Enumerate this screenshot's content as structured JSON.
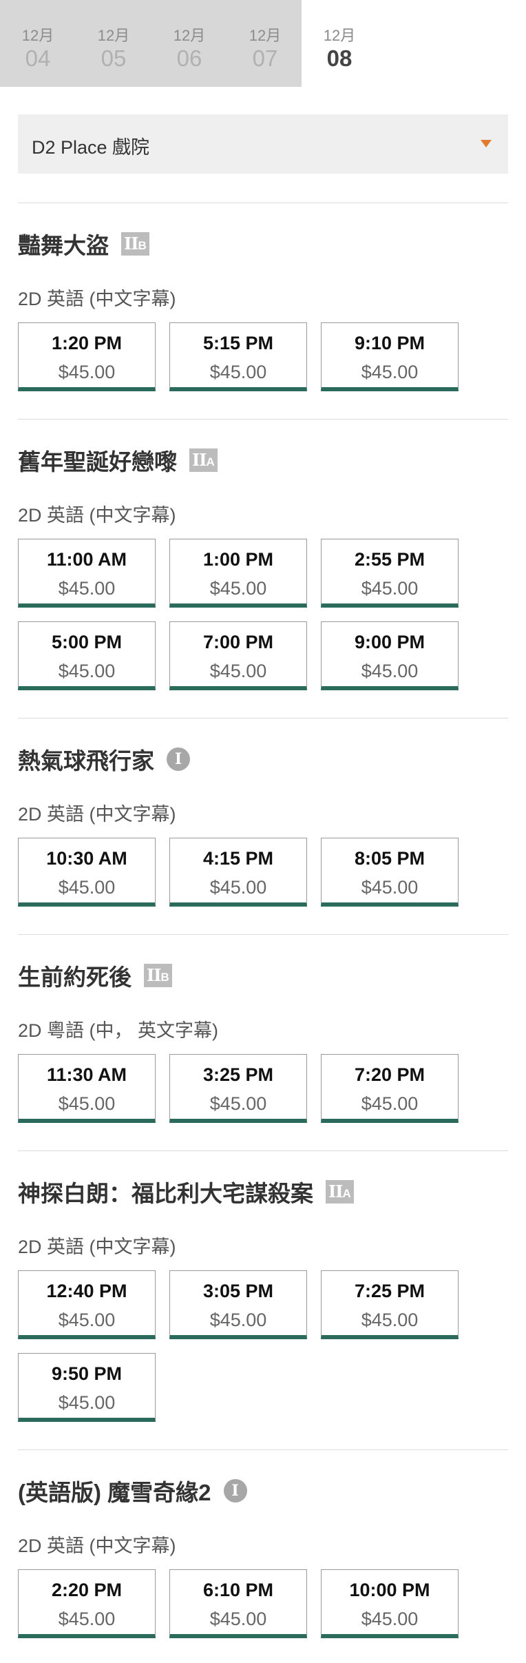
{
  "dates": [
    {
      "month": "12月",
      "day": "04"
    },
    {
      "month": "12月",
      "day": "05"
    },
    {
      "month": "12月",
      "day": "06"
    },
    {
      "month": "12月",
      "day": "07"
    },
    {
      "month": "12月",
      "day": "08"
    }
  ],
  "cinema": {
    "selected": "D2 Place 戲院"
  },
  "colors": {
    "accent": "#e27a2f",
    "slot_border": "#2b6b5c"
  },
  "movies": [
    {
      "title": "豔舞大盜",
      "rating": "IIB",
      "rating_main": "II",
      "rating_sub": "B",
      "format": "2D 英語 (中文字幕)",
      "slots": [
        {
          "time": "1:20 PM",
          "price": "$45.00"
        },
        {
          "time": "5:15 PM",
          "price": "$45.00"
        },
        {
          "time": "9:10 PM",
          "price": "$45.00"
        }
      ]
    },
    {
      "title": "舊年聖誕好戀嚟",
      "rating": "IIA",
      "rating_main": "II",
      "rating_sub": "A",
      "format": "2D 英語 (中文字幕)",
      "slots": [
        {
          "time": "11:00 AM",
          "price": "$45.00"
        },
        {
          "time": "1:00 PM",
          "price": "$45.00"
        },
        {
          "time": "2:55 PM",
          "price": "$45.00"
        },
        {
          "time": "5:00 PM",
          "price": "$45.00"
        },
        {
          "time": "7:00 PM",
          "price": "$45.00"
        },
        {
          "time": "9:00 PM",
          "price": "$45.00"
        }
      ]
    },
    {
      "title": "熱氣球飛行家",
      "rating": "I",
      "rating_main": "I",
      "rating_sub": "",
      "format": "2D 英語 (中文字幕)",
      "slots": [
        {
          "time": "10:30 AM",
          "price": "$45.00"
        },
        {
          "time": "4:15 PM",
          "price": "$45.00"
        },
        {
          "time": "8:05 PM",
          "price": "$45.00"
        }
      ]
    },
    {
      "title": "生前約死後",
      "rating": "IIB",
      "rating_main": "II",
      "rating_sub": "B",
      "format": "2D 粵語 (中， 英文字幕)",
      "slots": [
        {
          "time": "11:30 AM",
          "price": "$45.00"
        },
        {
          "time": "3:25 PM",
          "price": "$45.00"
        },
        {
          "time": "7:20 PM",
          "price": "$45.00"
        }
      ]
    },
    {
      "title": "神探白朗：福比利大宅謀殺案",
      "rating": "IIA",
      "rating_main": "II",
      "rating_sub": "A",
      "format": "2D 英語 (中文字幕)",
      "slots": [
        {
          "time": "12:40 PM",
          "price": "$45.00"
        },
        {
          "time": "3:05 PM",
          "price": "$45.00"
        },
        {
          "time": "7:25 PM",
          "price": "$45.00"
        },
        {
          "time": "9:50 PM",
          "price": "$45.00"
        }
      ]
    },
    {
      "title": "(英語版) 魔雪奇緣2",
      "rating": "I",
      "rating_main": "I",
      "rating_sub": "",
      "format": "2D 英語 (中文字幕)",
      "slots": [
        {
          "time": "2:20 PM",
          "price": "$45.00"
        },
        {
          "time": "6:10 PM",
          "price": "$45.00"
        },
        {
          "time": "10:00 PM",
          "price": "$45.00"
        }
      ]
    }
  ]
}
